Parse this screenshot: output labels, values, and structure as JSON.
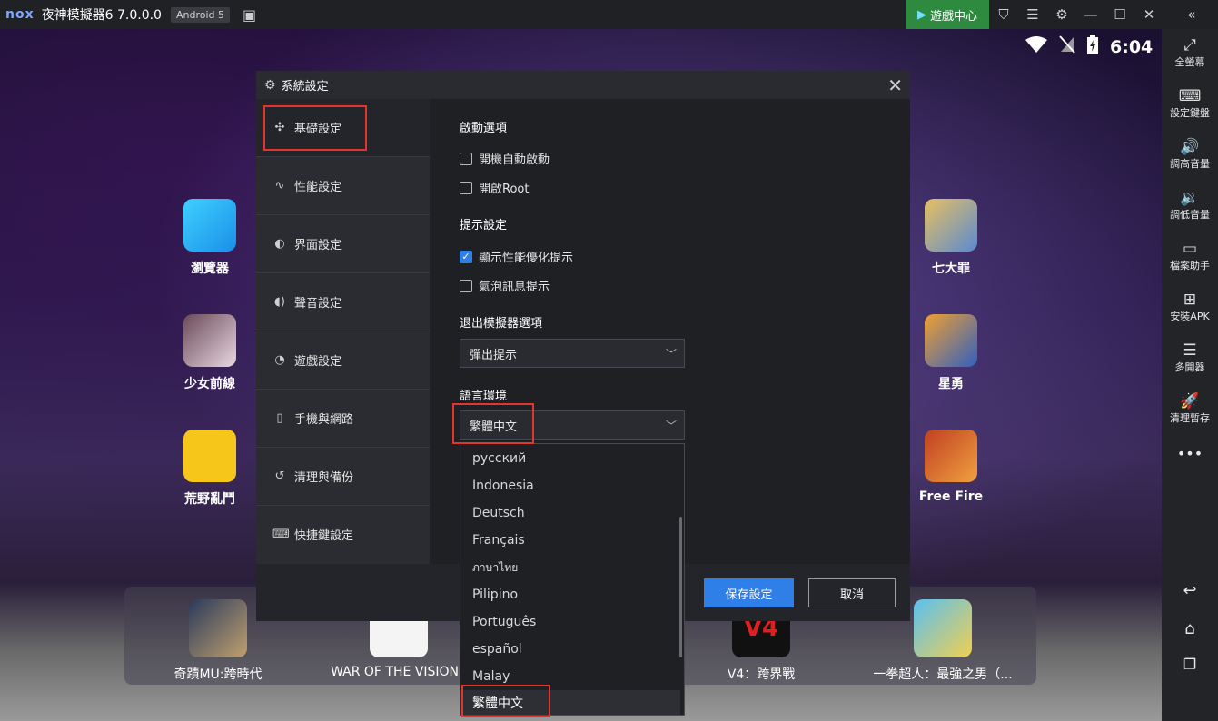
{
  "window": {
    "logo": "nox",
    "title": "夜神模擬器6 7.0.0.0",
    "android_badge": "Android 5",
    "game_center": "遊戲中心"
  },
  "status_bar": {
    "time": "6:04"
  },
  "sidebar": {
    "items": [
      {
        "label": "全螢幕",
        "icon": "fullscreen-icon"
      },
      {
        "label": "設定鍵盤",
        "icon": "keyboard-icon"
      },
      {
        "label": "調高音量",
        "icon": "volume-up-icon"
      },
      {
        "label": "調低音量",
        "icon": "volume-down-icon"
      },
      {
        "label": "檔案助手",
        "icon": "file-icon"
      },
      {
        "label": "安裝APK",
        "icon": "apk-icon"
      },
      {
        "label": "多開器",
        "icon": "multi-instance-icon"
      },
      {
        "label": "清理暫存",
        "icon": "rocket-icon"
      }
    ]
  },
  "desktop": {
    "apps": [
      {
        "label": "瀏覽器"
      },
      {
        "label": "少女前線"
      },
      {
        "label": "荒野亂鬥"
      },
      {
        "label": "七大罪"
      },
      {
        "label": "星勇"
      },
      {
        "label": "Free Fire"
      }
    ],
    "dock": [
      {
        "label": "奇蹟MU:跨時代"
      },
      {
        "label": "WAR OF THE VISIONS"
      },
      {
        "label": "V4：跨界戰"
      },
      {
        "label": "一拳超人：最強之男（..."
      }
    ]
  },
  "dialog": {
    "title": "系統設定",
    "nav": [
      {
        "label": "基礎設定",
        "icon": "puzzle-icon"
      },
      {
        "label": "性能設定",
        "icon": "pulse-icon"
      },
      {
        "label": "界面設定",
        "icon": "palette-icon"
      },
      {
        "label": "聲音設定",
        "icon": "sound-icon"
      },
      {
        "label": "遊戲設定",
        "icon": "gamepad-icon"
      },
      {
        "label": "手機與網路",
        "icon": "phone-icon"
      },
      {
        "label": "清理與備份",
        "icon": "backup-icon"
      },
      {
        "label": "快捷鍵設定",
        "icon": "keyboard-icon"
      }
    ],
    "startup": {
      "title": "啟動選項",
      "autostart": "開機自動啟動",
      "root": "開啟Root"
    },
    "hints": {
      "title": "提示設定",
      "perf_tip": "顯示性能優化提示",
      "bubble": "氣泡訊息提示"
    },
    "exit": {
      "title": "退出模擬器選項",
      "value": "彈出提示"
    },
    "language": {
      "title": "語言環境",
      "value": "繁體中文",
      "options": [
        "русский",
        "Indonesia",
        "Deutsch",
        "Français",
        "ภาษาไทย",
        "Pilipino",
        "Português",
        "español",
        "Malay",
        "繁體中文"
      ]
    },
    "save": "保存設定",
    "cancel": "取消"
  },
  "colors": {
    "accent": "#2f7fe8",
    "highlight": "#e0362e",
    "game_center": "#2d8a3e"
  }
}
